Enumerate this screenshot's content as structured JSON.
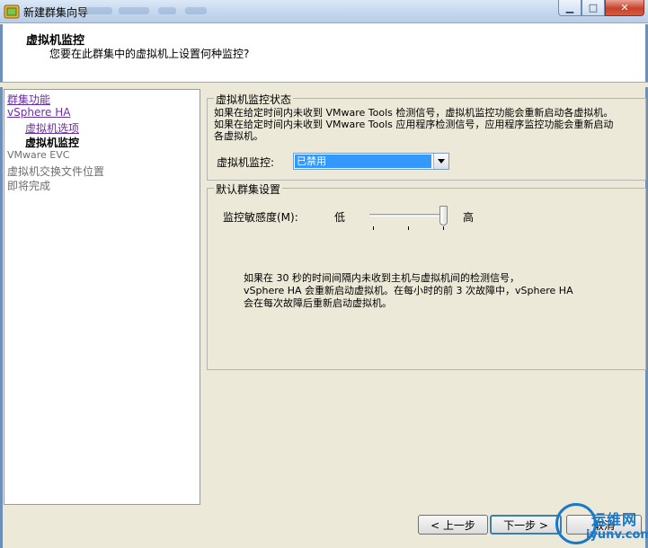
{
  "window": {
    "title": "新建群集向导"
  },
  "header": {
    "title": "虚拟机监控",
    "subtitle": "您要在此群集中的虚拟机上设置何种监控?"
  },
  "nav": {
    "items": [
      {
        "label": "群集功能",
        "state": "link"
      },
      {
        "label": "vSphere HA",
        "state": "link"
      },
      {
        "label": "虚拟机选项",
        "state": "link"
      },
      {
        "label": "虚拟机监控",
        "state": "current"
      },
      {
        "label": "VMware EVC",
        "state": "disabled"
      },
      {
        "label": "虚拟机交换文件位置",
        "state": "disabled"
      },
      {
        "label": "即将完成",
        "state": "disabled"
      }
    ]
  },
  "vm_monitoring": {
    "legend": "虚拟机监控状态",
    "desc_line1": "如果在给定时间内未收到 VMware Tools 检测信号，虚拟机监控功能会重新启动各虚拟机。",
    "desc_line2": "如果在给定时间内未收到 VMware Tools 应用程序检测信号，应用程序监控功能会重新启动",
    "desc_line3": "各虚拟机。",
    "field_label": "虚拟机监控:",
    "selected_value": "已禁用"
  },
  "default_settings": {
    "legend": "默认群集设置",
    "sensitivity_label": "监控敏感度(M):",
    "low_label": "低",
    "high_label": "高",
    "sensitivity_level": 1.0,
    "info_line1": "如果在 30 秒的时间间隔内未收到主机与虚拟机间的检测信号，",
    "info_line2": "vSphere HA 会重新启动虚拟机。在每小时的前 3 次故障中，vSphere HA",
    "info_line3": "会在每次故障后重新启动虚拟机。"
  },
  "buttons": {
    "back": "< 上一步",
    "next": "下一步 >",
    "cancel": "取消"
  },
  "watermark": {
    "line1": "运维网",
    "line2": "iyunv.com"
  }
}
